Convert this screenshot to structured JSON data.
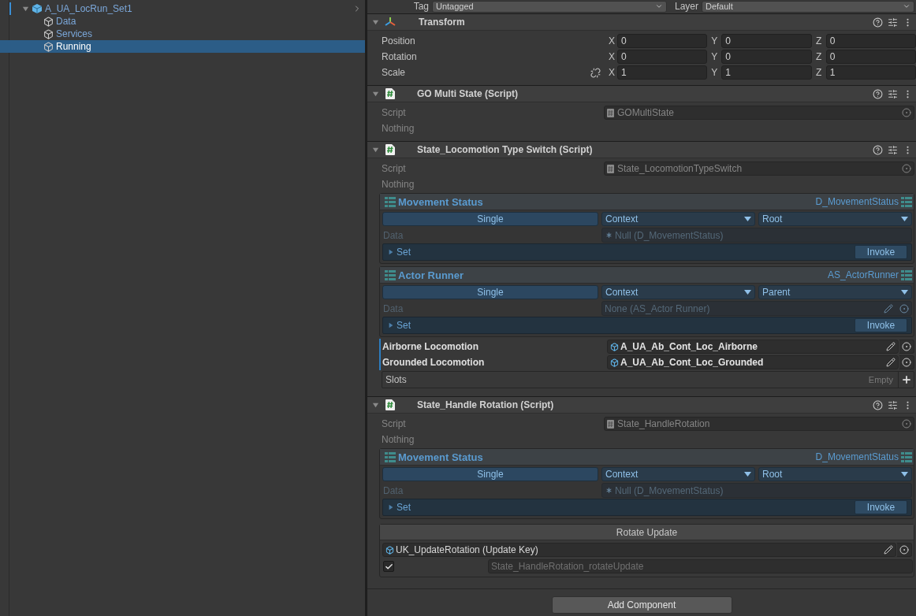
{
  "hierarchy": {
    "root": {
      "label": "A_UA_LocRun_Set1",
      "expanded": true,
      "children": [
        {
          "label": "Data",
          "selected": false
        },
        {
          "label": "Services",
          "selected": false
        },
        {
          "label": "Running",
          "selected": true
        }
      ]
    }
  },
  "inspector": {
    "header_fields": [
      {
        "label": "Tag",
        "value": "Untagged"
      },
      {
        "label": "Layer",
        "value": "Default"
      }
    ],
    "components": [
      {
        "kind": "transform",
        "title": "Transform",
        "expanded": true,
        "rows": [
          {
            "label": "Position",
            "values": [
              {
                "axis": "X",
                "value": "0"
              },
              {
                "axis": "Y",
                "value": "0"
              },
              {
                "axis": "Z",
                "value": "0"
              }
            ]
          },
          {
            "label": "Rotation",
            "values": [
              {
                "axis": "X",
                "value": "0"
              },
              {
                "axis": "Y",
                "value": "0"
              },
              {
                "axis": "Z",
                "value": "0"
              }
            ]
          },
          {
            "label": "Scale",
            "proportional_lock": false,
            "values": [
              {
                "axis": "X",
                "value": "1"
              },
              {
                "axis": "Y",
                "value": "1"
              },
              {
                "axis": "Z",
                "value": "1"
              }
            ]
          }
        ]
      },
      {
        "kind": "script",
        "title": "GO Multi State (Script)",
        "expanded": true,
        "script_label": "Script",
        "script": "GOMultiState",
        "note": "Nothing"
      },
      {
        "kind": "script",
        "title": "State_Locomotion Type Switch (Script)",
        "expanded": true,
        "script_label": "Script",
        "script": "State_LocomotionTypeSwitch",
        "note": "Nothing",
        "blocks": [
          {
            "kind": "data_ref",
            "title": "Movement Status",
            "type": "D_MovementStatus",
            "mode": "Single",
            "source": "Context",
            "scope": "Root",
            "data_label": "Data",
            "data_value": "Null (D_MovementStatus)",
            "null_marker": true,
            "editable": false,
            "set_label": "Set",
            "invoke": "Invoke"
          },
          {
            "kind": "data_ref",
            "title": "Actor Runner",
            "type": "AS_ActorRunner",
            "mode": "Single",
            "source": "Context",
            "scope": "Parent",
            "data_label": "Data",
            "data_value": "None (AS_Actor Runner)",
            "null_marker": false,
            "editable": true,
            "set_label": "Set",
            "invoke": "Invoke"
          },
          {
            "kind": "object_field",
            "label": "Airborne Locomotion",
            "value": "A_UA_Ab_Cont_Loc_Airborne"
          },
          {
            "kind": "object_field",
            "label": "Grounded Locomotion",
            "value": "A_UA_Ab_Cont_Loc_Grounded"
          },
          {
            "kind": "list",
            "label": "Slots",
            "badge": "Empty"
          }
        ]
      },
      {
        "kind": "script",
        "title": "State_Handle Rotation (Script)",
        "expanded": true,
        "script_label": "Script",
        "script": "State_HandleRotation",
        "note": "Nothing",
        "blocks": [
          {
            "kind": "data_ref",
            "title": "Movement Status",
            "type": "D_MovementStatus",
            "mode": "Single",
            "source": "Context",
            "scope": "Root",
            "data_label": "Data",
            "data_value": "Null (D_MovementStatus)",
            "null_marker": true,
            "editable": false,
            "set_label": "Set",
            "invoke": "Invoke"
          },
          {
            "kind": "event",
            "title": "Rotate Update",
            "key": "UK_UpdateRotation (Update Key)",
            "checked": true,
            "placeholder": "State_HandleRotation_rotateUpdate"
          }
        ]
      }
    ],
    "add_button": "Add Component"
  }
}
